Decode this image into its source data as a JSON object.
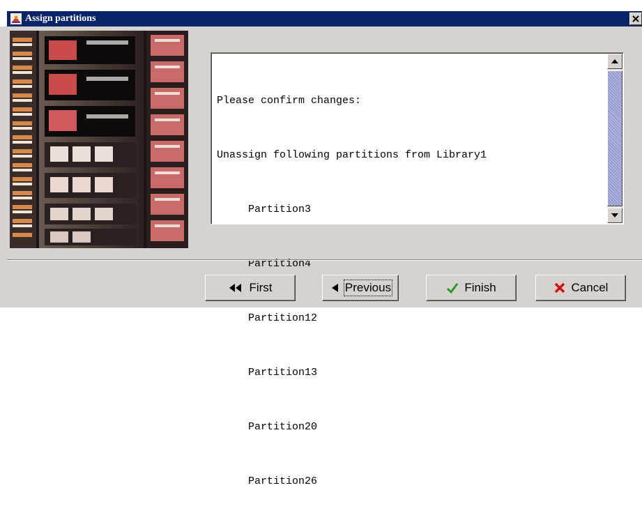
{
  "window": {
    "title": "Assign partitions"
  },
  "confirmation": {
    "heading": "Please confirm changes:",
    "action_line": "Unassign following partitions from Library1",
    "partitions": [
      "Partition3",
      "Partition4",
      "Partition12",
      "Partition13",
      "Partition20",
      "Partition26"
    ]
  },
  "buttons": {
    "first": "First",
    "previous": "Previous",
    "finish": "Finish",
    "cancel": "Cancel"
  },
  "colors": {
    "titlebar": "#0a246a",
    "dialog_bg": "#d6d3ce",
    "scroll_thumb": "#aeb2dc",
    "finish_check": "#2a9a2a",
    "cancel_x": "#d01010"
  },
  "icons": {
    "title": "java-app-icon",
    "close": "close-icon",
    "first": "double-left-arrow-icon",
    "previous": "left-arrow-icon",
    "finish": "checkmark-icon",
    "cancel": "red-x-icon"
  }
}
